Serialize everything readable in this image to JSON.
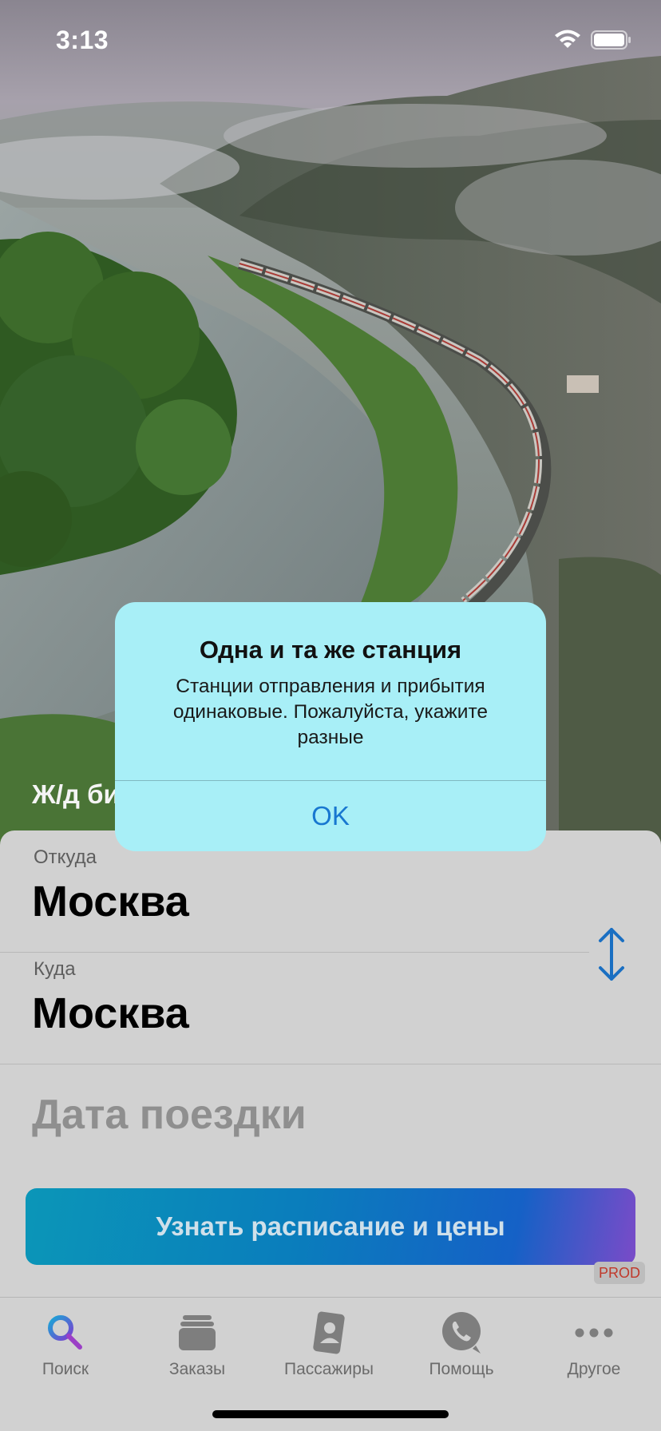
{
  "status_bar": {
    "time": "3:13"
  },
  "hero": {
    "title": "Ж/д билеты"
  },
  "form": {
    "from_label": "Откуда",
    "from_value": "Москва",
    "to_label": "Куда",
    "to_value": "Москва",
    "date_placeholder": "Дата поездки",
    "search_button": "Узнать расписание и цены",
    "env_badge": "PROD"
  },
  "alert": {
    "title": "Одна и та же станция",
    "message": "Станции отправления и прибытия одинаковые. Пожалуйста, укажите разные",
    "ok_button": "OK"
  },
  "tabs": [
    {
      "label": "Поиск",
      "icon": "search-icon",
      "active": true
    },
    {
      "label": "Заказы",
      "icon": "orders-icon",
      "active": false
    },
    {
      "label": "Пассажиры",
      "icon": "passenger-card-icon",
      "active": false
    },
    {
      "label": "Помощь",
      "icon": "phone-icon",
      "active": false
    },
    {
      "label": "Другое",
      "icon": "more-icon",
      "active": false
    }
  ],
  "colors": {
    "accent": "#1877d0",
    "active_tab": "#1e5fbf",
    "alert_bg": "#a8eff7"
  }
}
